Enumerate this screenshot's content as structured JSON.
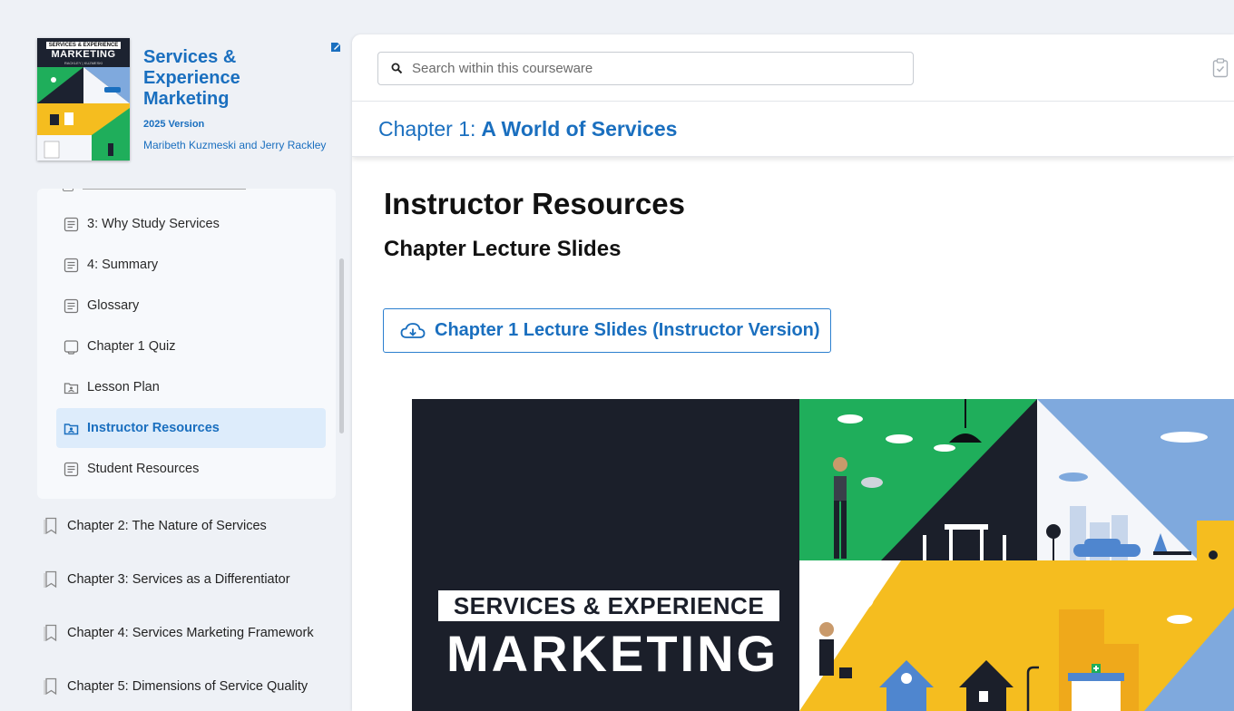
{
  "book": {
    "cover_top": "SERVICES & EXPERIENCE",
    "cover_title": "MARKETING",
    "cover_authors": "RACKLEY | KUZMESKI",
    "title": "Services & Experience Marketing",
    "version": "2025 Version",
    "authors": "Maribeth Kuzmeski and Jerry Rackley"
  },
  "toc": {
    "items": [
      {
        "label": "3: Why Study Services",
        "icon": "document-icon"
      },
      {
        "label": "4: Summary",
        "icon": "document-icon"
      },
      {
        "label": "Glossary",
        "icon": "document-icon"
      },
      {
        "label": "Chapter 1 Quiz",
        "icon": "quiz-icon"
      },
      {
        "label": "Lesson Plan",
        "icon": "folder-icon"
      },
      {
        "label": "Instructor Resources",
        "icon": "folder-icon",
        "active": true
      },
      {
        "label": "Student Resources",
        "icon": "document-icon"
      }
    ]
  },
  "chapters": [
    "Chapter 2: The Nature of Services",
    "Chapter 3: Services as a Differentiator",
    "Chapter 4: Services Marketing Framework",
    "Chapter 5: Dimensions of Service Quality"
  ],
  "search": {
    "placeholder": "Search within this courseware"
  },
  "header": {
    "chapter_prefix": "Chapter 1:",
    "chapter_name": "A World of Services"
  },
  "content": {
    "title": "Instructor Resources",
    "subtitle": "Chapter Lecture Slides",
    "download_label": "Chapter 1 Lecture Slides (Instructor Version)"
  },
  "hero": {
    "tag": "SERVICES & EXPERIENCE",
    "big": "MARKETING"
  },
  "colors": {
    "accent": "#1a6fbf",
    "active_bg": "#ddecfb",
    "sidebar_bg": "#eef1f6",
    "hero_dark": "#1b1f2a",
    "green": "#1fae5b",
    "yellow": "#f5bd1f",
    "sky": "#7fa9dd"
  }
}
